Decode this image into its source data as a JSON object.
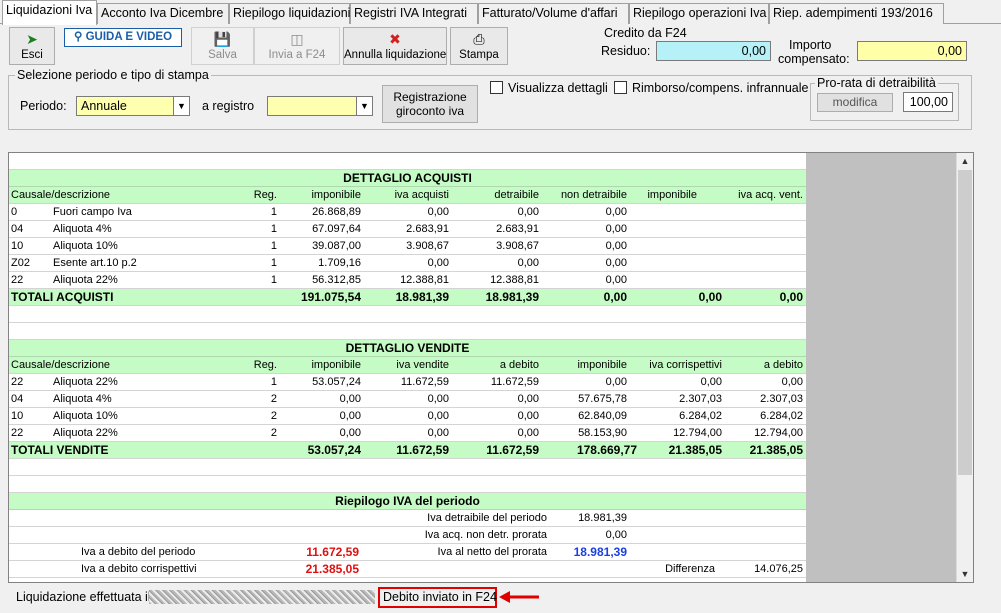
{
  "tabs": [
    "Liquidazioni Iva",
    "Acconto Iva Dicembre",
    "Riepilogo liquidazioni",
    "Registri IVA Integrati",
    "Fatturato/Volume d'affari",
    "Riepilogo operazioni Iva",
    "Riep. adempimenti 193/2016"
  ],
  "toolbar": {
    "esci": "Esci",
    "guida": "GUIDA E VIDEO",
    "salva": "Salva",
    "invia": "Invia a F24",
    "annulla": "Annulla liquidazione",
    "stampa": "Stampa"
  },
  "credito": {
    "title": "Credito da F24",
    "residuo_label": "Residuo:",
    "residuo_value": "0,00",
    "importo_label1": "Importo",
    "importo_label2": "compensato:",
    "importo_value": "0,00"
  },
  "periodo": {
    "title": "Selezione periodo e tipo di stampa",
    "periodo_label": "Periodo:",
    "periodo_value": "Annuale",
    "registro_label": "a registro",
    "registro_value": "",
    "reg_button1": "Registrazione",
    "reg_button2": "giroconto iva"
  },
  "options": {
    "visualizza": "Visualizza dettagli",
    "rimborso": "Rimborso/compens. infrannuale"
  },
  "prorata": {
    "title": "Pro-rata di detraibilità",
    "modifica": "modifica",
    "value": "100,00"
  },
  "acquisti": {
    "title": "DETTAGLIO ACQUISTI",
    "headers": [
      "Causale/descrizione",
      "Reg.",
      "imponibile",
      "iva acquisti",
      "detraibile",
      "non detraibile",
      "imponibile",
      "iva acq. vent."
    ],
    "rows": [
      {
        "code": "0",
        "desc": "Fuori campo Iva",
        "reg": "1",
        "imp": "26.868,89",
        "iva": "0,00",
        "detr": "0,00",
        "nondetr": "0,00"
      },
      {
        "code": "04",
        "desc": "Aliquota 4%",
        "reg": "1",
        "imp": "67.097,64",
        "iva": "2.683,91",
        "detr": "2.683,91",
        "nondetr": "0,00"
      },
      {
        "code": "10",
        "desc": "Aliquota 10%",
        "reg": "1",
        "imp": "39.087,00",
        "iva": "3.908,67",
        "detr": "3.908,67",
        "nondetr": "0,00"
      },
      {
        "code": "Z02",
        "desc": "Esente art.10 p.2",
        "reg": "1",
        "imp": "1.709,16",
        "iva": "0,00",
        "detr": "0,00",
        "nondetr": "0,00"
      },
      {
        "code": "22",
        "desc": "Aliquota 22%",
        "reg": "1",
        "imp": "56.312,85",
        "iva": "12.388,81",
        "detr": "12.388,81",
        "nondetr": "0,00"
      }
    ],
    "total": {
      "label": "TOTALI ACQUISTI",
      "imp": "191.075,54",
      "iva": "18.981,39",
      "detr": "18.981,39",
      "nondetr": "0,00",
      "imp2": "0,00",
      "ivavent": "0,00"
    }
  },
  "vendite": {
    "title": "DETTAGLIO VENDITE",
    "headers": [
      "Causale/descrizione",
      "Reg.",
      "imponibile",
      "iva vendite",
      "a debito",
      "imponibile",
      "iva corrispettivi",
      "a debito"
    ],
    "rows": [
      {
        "code": "22",
        "desc": "Aliquota 22%",
        "reg": "1",
        "imp": "53.057,24",
        "iva": "11.672,59",
        "deb": "11.672,59",
        "imp2": "0,00",
        "ivacorr": "0,00",
        "deb2": "0,00"
      },
      {
        "code": "04",
        "desc": "Aliquota 4%",
        "reg": "2",
        "imp": "0,00",
        "iva": "0,00",
        "deb": "0,00",
        "imp2": "57.675,78",
        "ivacorr": "2.307,03",
        "deb2": "2.307,03"
      },
      {
        "code": "10",
        "desc": "Aliquota 10%",
        "reg": "2",
        "imp": "0,00",
        "iva": "0,00",
        "deb": "0,00",
        "imp2": "62.840,09",
        "ivacorr": "6.284,02",
        "deb2": "6.284,02"
      },
      {
        "code": "22",
        "desc": "Aliquota 22%",
        "reg": "2",
        "imp": "0,00",
        "iva": "0,00",
        "deb": "0,00",
        "imp2": "58.153,90",
        "ivacorr": "12.794,00",
        "deb2": "12.794,00"
      }
    ],
    "total": {
      "label": "TOTALI VENDITE",
      "imp": "53.057,24",
      "iva": "11.672,59",
      "deb": "11.672,59",
      "imp2": "178.669,77",
      "ivacorr": "21.385,05",
      "deb2": "21.385,05"
    }
  },
  "riepilogo": {
    "title": "Riepilogo IVA del periodo",
    "detraibile_label": "Iva detraibile del periodo",
    "detraibile_value": "18.981,39",
    "nondetr_label": "Iva acq. non detr. prorata",
    "nondetr_value": "0,00",
    "debito_label": "Iva a debito del periodo",
    "debito_value": "11.672,59",
    "netto_label": "Iva al netto del prorata",
    "netto_value": "18.981,39",
    "corrisp_label": "Iva a debito corrispettivi",
    "corrisp_value": "21.385,05",
    "diff_label": "Differenza",
    "diff_value": "14.076,25"
  },
  "status": {
    "prefix": "Liquidazione effettuata il",
    "debito": "Debito inviato in F24"
  },
  "colors": {
    "accent_green": "#c5fcc5",
    "red": "#e01010",
    "blue": "#1a3ee8",
    "highlight": "#e00000"
  }
}
